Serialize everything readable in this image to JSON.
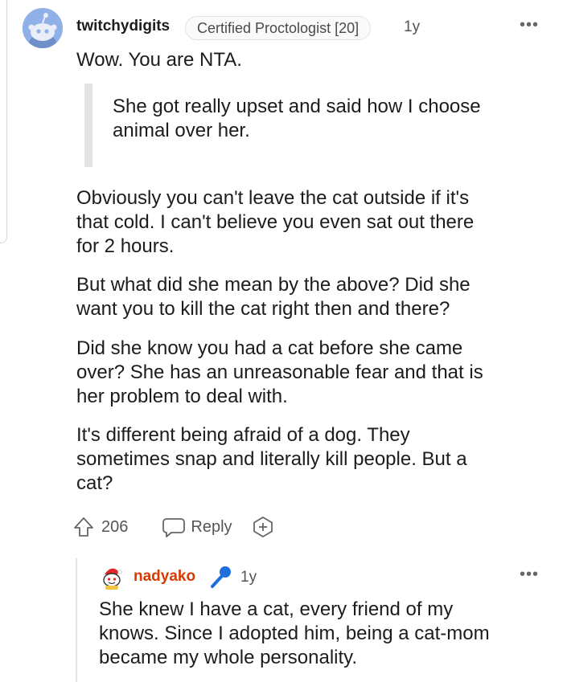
{
  "comment": {
    "username": "twitchydigits",
    "flair": "Certified Proctologist [20]",
    "age": "1y",
    "more": "•••",
    "intro": "Wow. You are NTA.",
    "quote": [
      "She got really upset and said how I choose",
      "animal over her."
    ],
    "paragraphs": [
      [
        "Obviously you can't leave the cat outside if it's",
        "that cold. I can't believe you even sat out there",
        "for 2 hours."
      ],
      [
        "But what did she mean by the above? Did she",
        "want you to kill the cat right then and there?"
      ],
      [
        "Did she know you had a cat before she came",
        "over? She has an unreasonable fear and that is",
        "her problem to deal with."
      ],
      [
        "It's different being afraid of a dog. They",
        "sometimes snap and literally kill people. But a",
        "cat?"
      ]
    ],
    "upvotes": "206",
    "reply_label": "Reply"
  },
  "reply": {
    "username": "nadyako",
    "age": "1y",
    "more": "•••",
    "lines": [
      "She knew I have a cat, every friend of my",
      "knows. Since I adopted him, being a cat-mom",
      "became my whole personality."
    ]
  },
  "colors": {
    "accent": "#d93a00",
    "snoo_bg": "#8fb1e8",
    "mic": "#1e6fdc"
  }
}
